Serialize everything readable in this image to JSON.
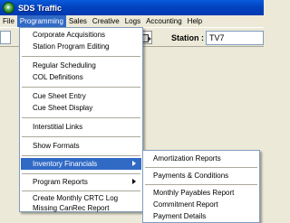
{
  "window": {
    "title": "SDS Traffic"
  },
  "menubar": [
    {
      "label": "File"
    },
    {
      "label": "Programming"
    },
    {
      "label": "Sales"
    },
    {
      "label": "Creative"
    },
    {
      "label": "Logs"
    },
    {
      "label": "Accounting"
    },
    {
      "label": "Help"
    }
  ],
  "toolbar": {
    "station_label": "Station :",
    "station_value": "TV7"
  },
  "programming_menu": [
    {
      "label": "Corporate Acquisitions"
    },
    {
      "label": "Station Program Editing"
    },
    {
      "label": "Regular Scheduling"
    },
    {
      "label": "COL Definitions"
    },
    {
      "label": "Cue Sheet Entry"
    },
    {
      "label": "Cue Sheet Display"
    },
    {
      "label": "Interstitial Links"
    },
    {
      "label": "Show Formats"
    },
    {
      "label": "Inventory Financials",
      "submenu": true,
      "highlighted": true
    },
    {
      "label": "Program Reports",
      "submenu": true
    },
    {
      "label": "Create Monthly CRTC Log"
    },
    {
      "label": "Missing CanRec Report"
    }
  ],
  "inventory_financials_submenu": [
    {
      "label": "Amortization Reports"
    },
    {
      "label": "Payments & Conditions"
    },
    {
      "label": "Monthly Payables Report"
    },
    {
      "label": "Commitment Report"
    },
    {
      "label": "Payment Details"
    }
  ],
  "icons": {
    "app": "sds-app-icon",
    "toolbar_button": "layout-arrow-icon",
    "submenu_arrow": "triangle-right-icon"
  },
  "colors": {
    "title_bar": "#0243c0",
    "highlight": "#316ac5",
    "menu_background": "#ffffff",
    "window_background": "#ece9d8"
  }
}
